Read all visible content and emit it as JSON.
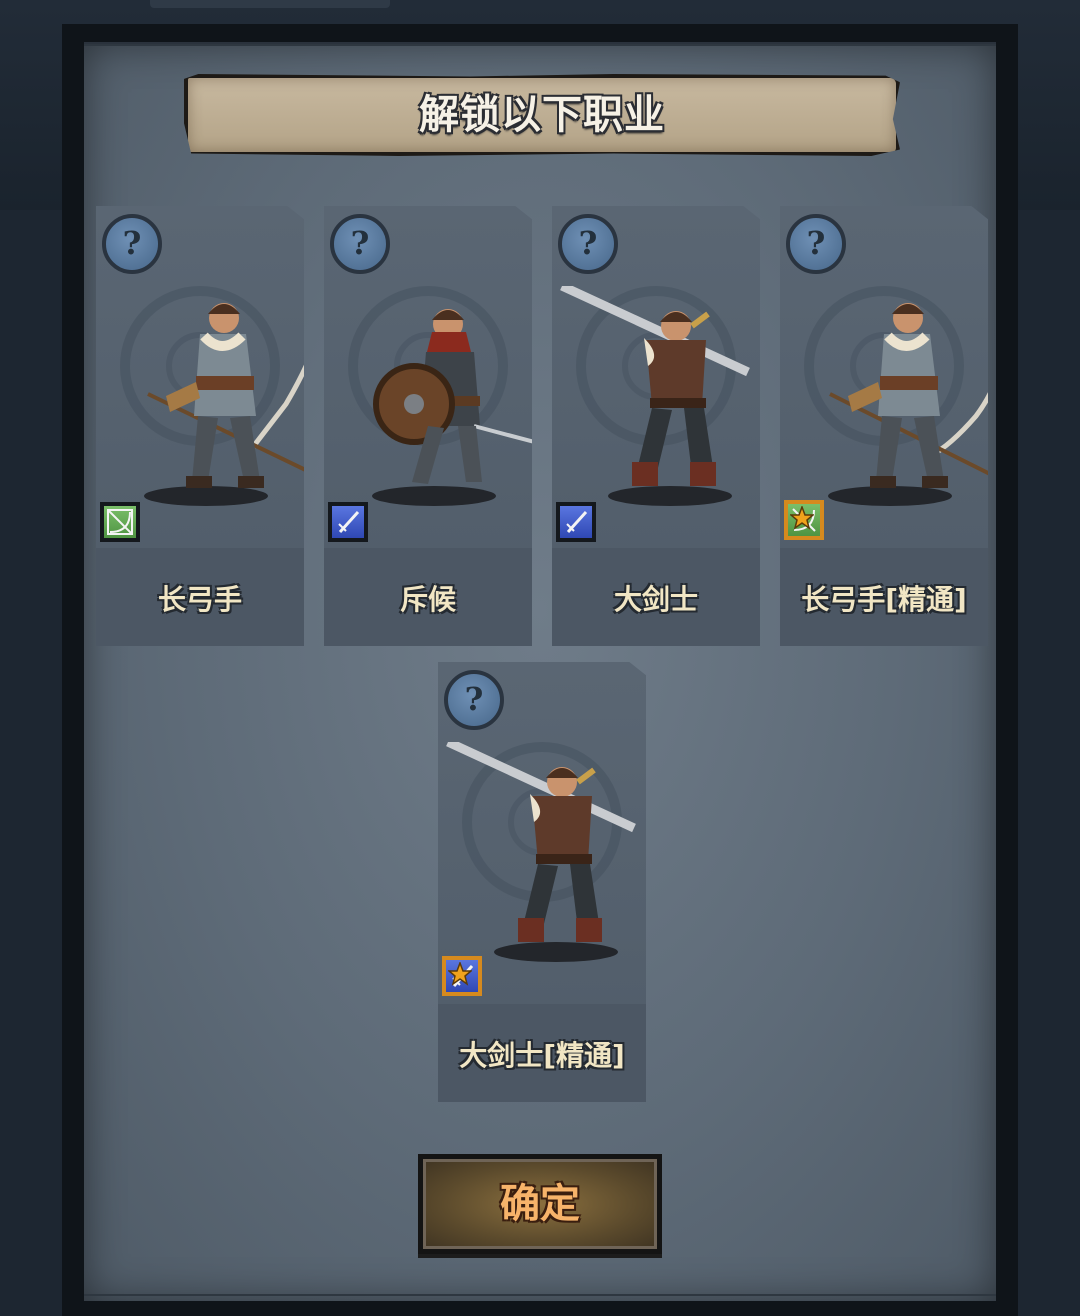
{
  "dialog": {
    "title": "解锁以下职业",
    "confirm_label": "确定"
  },
  "classes": [
    {
      "name": "长弓手",
      "badge_icon": "bow-icon",
      "badge_color": "#5fa84f",
      "elite": false,
      "figure": "archer-figure"
    },
    {
      "name": "斥候",
      "badge_icon": "dagger-icon",
      "badge_color": "#3d5bd0",
      "elite": false,
      "figure": "scout-figure"
    },
    {
      "name": "大剑士",
      "badge_icon": "greatsword-icon",
      "badge_color": "#3d5bd0",
      "elite": false,
      "figure": "swordsman-figure"
    },
    {
      "name": "长弓手[精通]",
      "badge_icon": "bow-icon",
      "badge_color": "#5fa84f",
      "elite": true,
      "figure": "archer-figure"
    },
    {
      "name": "大剑士[精通]",
      "badge_icon": "greatsword-icon",
      "badge_color": "#3d5bd0",
      "elite": true,
      "figure": "swordsman-figure"
    }
  ],
  "help_icon": "question-mark-icon",
  "colors": {
    "accent_gold": "#d68a1e",
    "confirm_text": "#f7b36a",
    "name_text": "#f1e6c4"
  }
}
